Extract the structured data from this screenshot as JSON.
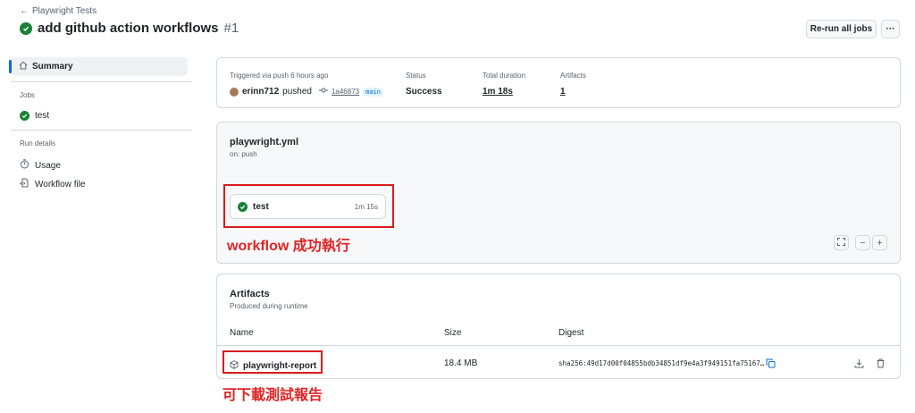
{
  "header": {
    "back_label": "Playwright Tests",
    "title": "add github action workflows",
    "run_number": "#1",
    "rerun_label": "Re-run all jobs",
    "more_label": "···"
  },
  "sidebar": {
    "summary_label": "Summary",
    "jobs_heading": "Jobs",
    "job_label": "test",
    "run_details_heading": "Run details",
    "usage_label": "Usage",
    "workflow_file_label": "Workflow file"
  },
  "run_info": {
    "trigger_label": "Triggered via push 6 hours ago",
    "user": "erinn712",
    "pushed_label": "pushed",
    "commit": "1a46873",
    "branch": "main",
    "status_label": "Status",
    "status_value": "Success",
    "duration_label": "Total duration",
    "duration_value": "1m 18s",
    "artifacts_label": "Artifacts",
    "artifacts_value": "1"
  },
  "workflow": {
    "file_name": "playwright.yml",
    "trigger": "on: push",
    "job_name": "test",
    "job_duration": "1m 15s",
    "annotation": "workflow 成功執行"
  },
  "artifacts": {
    "title": "Artifacts",
    "subtitle": "Produced during runtime",
    "columns": [
      "Name",
      "Size",
      "Digest"
    ],
    "rows": [
      {
        "name": "playwright-report",
        "size": "18.4 MB",
        "digest": "sha256:49d17d00f04855bdb34851df9e4a3f949151fa75167…"
      }
    ],
    "annotation": "可下載測試報告"
  },
  "colors": {
    "success": "#1a7f37",
    "accent": "#0969da",
    "annotation_red": "#e02424"
  }
}
